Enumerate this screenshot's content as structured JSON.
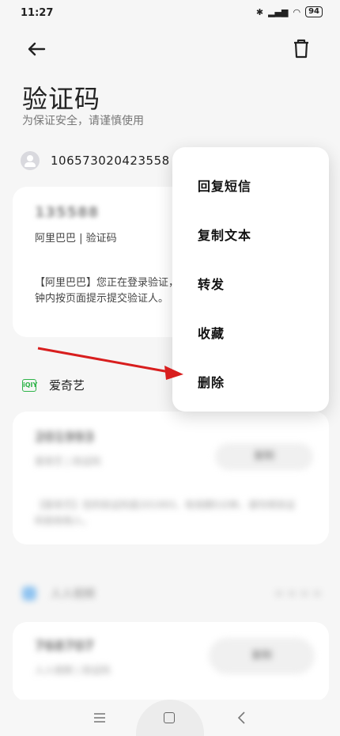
{
  "status_bar": {
    "time": "11:27",
    "battery": "94"
  },
  "header": {
    "title": "验证码",
    "subtitle": "为保证安全，请谨慎使用"
  },
  "sender": {
    "number": "10657302042355​8"
  },
  "card1": {
    "code": "135588",
    "label": "阿里巴巴 | 验证码",
    "body": "【阿里巴巴】您正在登录验证，分钟内按页面提示提交验证人。"
  },
  "app1": {
    "name": "爱奇艺",
    "icon_text": "iQIY"
  },
  "card2": {
    "code": "201993",
    "sub": "爱奇艺 | 验证码",
    "button": "复制",
    "body": "【爱奇艺】您的验证码是201993，有效期5分钟，请勿将验证码告知他人。"
  },
  "app2": {
    "name": "人人视频"
  },
  "card3": {
    "code": "768707",
    "sub": "人人视频 | 验证码",
    "button": "复制"
  },
  "context_menu": {
    "items": [
      "回复短信",
      "复制文本",
      "转发",
      "收藏",
      "删除"
    ]
  },
  "colors": {
    "annotation_arrow": "#d81e1e",
    "iqiyi_green": "#2fb34a"
  }
}
